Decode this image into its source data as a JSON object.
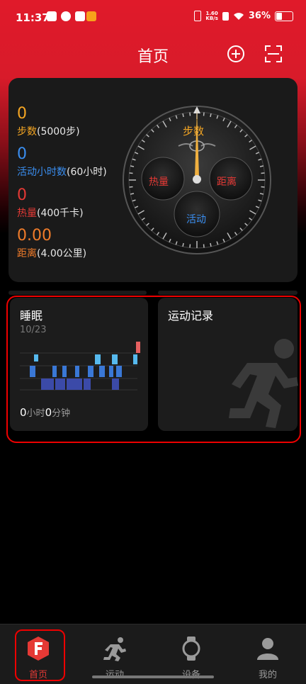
{
  "status_bar": {
    "time": "11:37",
    "net_speed": "1.60",
    "net_speed_unit": "KB/s",
    "battery": "36%"
  },
  "header": {
    "title": "首页",
    "add_icon": "plus-circle-icon",
    "scan_icon": "scan-icon"
  },
  "stats": {
    "steps": {
      "value": "0",
      "label": "步数",
      "goal": "(5000步)"
    },
    "active_hours": {
      "value": "0",
      "label": "活动小时数",
      "goal": "(60小时)"
    },
    "calories": {
      "value": "0",
      "label": "热量",
      "goal": "(400千卡)"
    },
    "distance": {
      "value": "0.00",
      "label": "距离",
      "goal": "(4.00公里)"
    }
  },
  "dial": {
    "steps_label": "步数",
    "calories_label": "热量",
    "distance_label": "距离",
    "activity_label": "活动"
  },
  "sleep_card": {
    "title": "睡眠",
    "date": "10/23",
    "hours": "0",
    "hours_unit": "小时",
    "minutes": "0",
    "minutes_unit": "分钟"
  },
  "exercise_card": {
    "title": "运动记录"
  },
  "nav": [
    {
      "label": "首页",
      "icon": "home-f-icon",
      "active": true
    },
    {
      "label": "运动",
      "icon": "running-icon",
      "active": false
    },
    {
      "label": "设备",
      "icon": "watch-icon",
      "active": false
    },
    {
      "label": "我的",
      "icon": "user-icon",
      "active": false
    }
  ],
  "colors": {
    "accent": "#e01a2a",
    "steps": "#f5a623",
    "active_hours": "#3a8ef0",
    "calories": "#e53935",
    "distance": "#f07c2a"
  }
}
